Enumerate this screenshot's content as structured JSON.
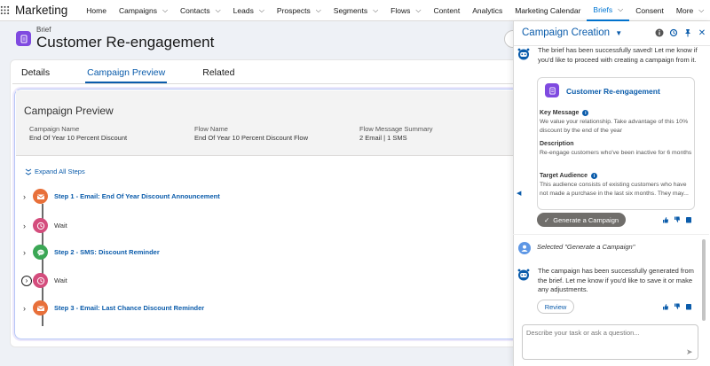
{
  "topnav": {
    "app_name": "Marketing",
    "items": [
      {
        "label": "Home",
        "has_menu": false
      },
      {
        "label": "Campaigns",
        "has_menu": true
      },
      {
        "label": "Contacts",
        "has_menu": true
      },
      {
        "label": "Leads",
        "has_menu": true
      },
      {
        "label": "Prospects",
        "has_menu": true
      },
      {
        "label": "Segments",
        "has_menu": true
      },
      {
        "label": "Flows",
        "has_menu": true
      },
      {
        "label": "Content",
        "has_menu": false
      },
      {
        "label": "Analytics",
        "has_menu": false
      },
      {
        "label": "Marketing Calendar",
        "has_menu": false
      },
      {
        "label": "Briefs",
        "has_menu": true,
        "active": true
      },
      {
        "label": "Consent",
        "has_menu": false
      },
      {
        "label": "More",
        "has_menu": true
      }
    ],
    "accent": "#0176d3"
  },
  "header": {
    "object_type": "Brief",
    "title": "Customer Re-engagement",
    "icon": "document-icon",
    "icon_color": "#7f4ae0"
  },
  "tabs": [
    {
      "label": "Details",
      "active": false
    },
    {
      "label": "Campaign Preview",
      "active": true
    },
    {
      "label": "Related",
      "active": false
    }
  ],
  "preview": {
    "title": "Campaign Preview",
    "fields": [
      {
        "label": "Campaign Name",
        "value": "End Of Year 10 Percent Discount"
      },
      {
        "label": "Flow Name",
        "value": "End Of Year 10 Percent Discount Flow"
      },
      {
        "label": "Flow Message Summary",
        "value": "2 Email | 1 SMS"
      }
    ],
    "expand_label": "Expand All Steps",
    "steps": [
      {
        "label": "Step 1 - Email: End Of Year Discount Announcement",
        "kind": "email",
        "icon": "email-icon",
        "color": "#e8703a",
        "link": true
      },
      {
        "label": "Wait",
        "kind": "wait",
        "icon": "clock-icon",
        "color": "#d44d7d",
        "link": false
      },
      {
        "label": "Step 2 - SMS: Discount Reminder",
        "kind": "sms",
        "icon": "sms-icon",
        "color": "#3ba755",
        "link": true
      },
      {
        "label": "Wait",
        "kind": "wait",
        "icon": "clock-icon",
        "color": "#d44d7d",
        "link": false
      },
      {
        "label": "Step 3 - Email: Last Chance Discount Reminder",
        "kind": "email",
        "icon": "email-icon",
        "color": "#e8703a",
        "link": true
      }
    ]
  },
  "panel": {
    "title": "Campaign Creation",
    "message1": "The brief has been successfully saved! Let me know if you'd like to proceed with creating a campaign from it.",
    "brief_card": {
      "title": "Customer Re-engagement",
      "key_message_label": "Key Message",
      "key_message": "We value your relationship. Take advantage of this 10% discount by the end of the year",
      "description_label": "Description",
      "description": "Re-engage customers who've been inactive for 6 months",
      "audience_label": "Target Audience",
      "audience": "This audience consists of existing customers who have not made a purchase in the last six months. They may..."
    },
    "generate_label": "Generate a Campaign",
    "user_message": "Selected \"Generate a Campaign\"",
    "message2": "The campaign has been successfully generated from the brief. Let me know if you'd like to save it or make any adjustments.",
    "review_label": "Review",
    "input_placeholder": "Describe your task or ask a question..."
  }
}
